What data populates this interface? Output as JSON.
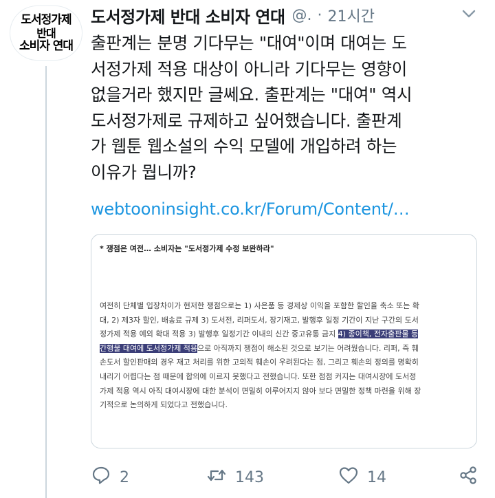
{
  "avatar": {
    "line1": "도서정가제",
    "line2": "반대",
    "line3": "소비자 연대"
  },
  "header": {
    "name": "도서정가제 반대 소비자 연대",
    "handle": "@.",
    "separator": "·",
    "time": "21시간"
  },
  "tweet": {
    "lines": [
      "출판계는 분명 기다무는 \"대여\"이며 대여는 도",
      "서정가제 적용 대상이 아니라 기다무는 영향이",
      "없을거라 했지만 글쎄요. 출판계는 \"대여\" 역시",
      "도서정가제로 규제하고 싶어했습니다. 출판계",
      "가 웹툰 웹소설의 수익 모델에 개입하려 하는",
      "이유가 뭡니까?"
    ],
    "link": "webtooninsight.co.kr/Forum/Content/…"
  },
  "card": {
    "heading": "* 쟁점은 여전… 소비자는 \"도서정가제 수정 보완하라\"",
    "lines": [
      {
        "before": "여전히 단체별 입장차이가 현저한 쟁점으로는 1) 사은품 등 경제상 이익을 포함한 할인율 축소 또는 확",
        "highlight": "",
        "after": ""
      },
      {
        "before": "대, 2) 제3자 할인, 배송료 규제 3) 도서전, 리퍼도서, 장기재고, 발행후 일정 기간이 지난 구간의 도서",
        "highlight": "",
        "after": ""
      },
      {
        "before": "정가제 적용 예외 확대 적용 3) 발행후 일정기간 이내의 신간 중고유통 금지 ",
        "highlight": "4) 종이책, 전자출판물 등",
        "after": ""
      },
      {
        "before": "",
        "highlight": "간행물 대여에 도서정가제 적용",
        "after": "으로 아직까지 쟁점이 해소된 것으로 보기는 어려웠습니다. 리퍼, 즉 훼"
      },
      {
        "before": "손도서 할인판매의 경우 재고 처리를 위한 고의적 훼손이 우려된다는 점, 그리고 훼손의 정의를 명확히",
        "highlight": "",
        "after": ""
      },
      {
        "before": "내리기 어렵다는 점 때문에 합의에 이르지 못했다고 전했습니다. 또한 점점 커지는 대여시장에 도서정",
        "highlight": "",
        "after": ""
      },
      {
        "before": "가제 적용 역시 아직 대여시장에 대한 분석이 면밀히 이루어지지 않아 보다 면밀한 정책 마련을 위해 장",
        "highlight": "",
        "after": ""
      },
      {
        "before": "기적으로 논의하게 되었다고 전했습니다.",
        "highlight": "",
        "after": ""
      }
    ],
    "highlight_color": "#3b3e78"
  },
  "actions": {
    "reply": {
      "icon": "reply-icon",
      "count": "2"
    },
    "retweet": {
      "icon": "retweet-icon",
      "count": "143"
    },
    "like": {
      "icon": "heart-icon",
      "count": "14"
    },
    "share": {
      "icon": "share-icon"
    }
  },
  "colors": {
    "link": "#1b95e0",
    "muted": "#657786",
    "text": "#14171a",
    "border": "#ccd6dd"
  }
}
